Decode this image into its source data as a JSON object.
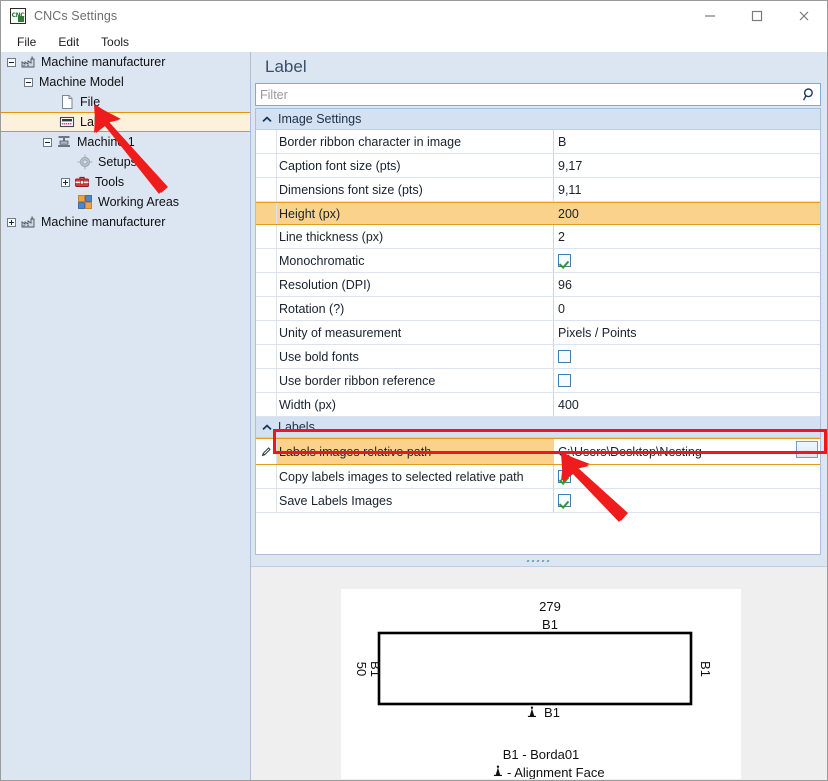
{
  "window": {
    "title": "CNCs Settings",
    "app_icon": "cnc-icon",
    "minimize_label": "Minimize",
    "maximize_label": "Maximize",
    "close_label": "Close"
  },
  "menubar": {
    "items": [
      {
        "label": "File",
        "name": "menu-file"
      },
      {
        "label": "Edit",
        "name": "menu-edit"
      },
      {
        "label": "Tools",
        "name": "menu-tools"
      }
    ]
  },
  "tree": {
    "nodes": [
      {
        "label": "Machine manufacturer",
        "icon": "factory-icon",
        "indent": 0,
        "expander": "minus",
        "selected": false
      },
      {
        "label": "Machine Model",
        "icon": "none",
        "indent": 1,
        "expander": "minus",
        "selected": false
      },
      {
        "label": "File",
        "icon": "document-icon",
        "indent": 2,
        "expander": "none",
        "selected": false
      },
      {
        "label": "Label",
        "icon": "label-icon",
        "indent": 2,
        "expander": "none",
        "selected": true
      },
      {
        "label": "Machine 1",
        "icon": "machine-icon",
        "indent": 2,
        "expander": "minus",
        "selected": false
      },
      {
        "label": "Setups",
        "icon": "gear-icon",
        "indent": 3,
        "expander": "none",
        "selected": false
      },
      {
        "label": "Tools",
        "icon": "toolbox-icon",
        "indent": 3,
        "expander": "plus",
        "selected": false
      },
      {
        "label": "Working Areas",
        "icon": "areas-icon",
        "indent": 3,
        "expander": "none",
        "selected": false
      },
      {
        "label": "Machine manufacturer",
        "icon": "factory-icon",
        "indent": 0,
        "expander": "plus",
        "selected": false
      }
    ]
  },
  "content": {
    "header": "Label",
    "filter": {
      "value": "",
      "placeholder": "Filter",
      "icon": "search-icon"
    },
    "categories": [
      {
        "name": "Image Settings",
        "chevron": "chevron-up-icon",
        "rows": [
          {
            "name": "Border ribbon character in image",
            "value": "B",
            "type": "text",
            "highlight": false,
            "gutter": "none"
          },
          {
            "name": "Caption font size (pts)",
            "value": "9,17",
            "type": "text",
            "highlight": false,
            "gutter": "none"
          },
          {
            "name": "Dimensions font size (pts)",
            "value": "9,11",
            "type": "text",
            "highlight": false,
            "gutter": "none"
          },
          {
            "name": "Height (px)",
            "value": "200",
            "type": "text",
            "highlight": true,
            "gutter": "none"
          },
          {
            "name": "Line thickness (px)",
            "value": "2",
            "type": "text",
            "highlight": false,
            "gutter": "none"
          },
          {
            "name": "Monochromatic",
            "value": "",
            "type": "checkbox",
            "checked": true,
            "highlight": false,
            "gutter": "none"
          },
          {
            "name": "Resolution (DPI)",
            "value": "96",
            "type": "text",
            "highlight": false,
            "gutter": "none"
          },
          {
            "name": "Rotation (?)",
            "value": "0",
            "type": "text",
            "highlight": false,
            "gutter": "none"
          },
          {
            "name": "Unity of measurement",
            "value": "Pixels / Points",
            "type": "text",
            "highlight": false,
            "gutter": "none"
          },
          {
            "name": "Use bold fonts",
            "value": "",
            "type": "checkbox",
            "checked": false,
            "highlight": false,
            "gutter": "none"
          },
          {
            "name": "Use border ribbon reference",
            "value": "",
            "type": "checkbox",
            "checked": false,
            "highlight": false,
            "gutter": "none"
          },
          {
            "name": "Width (px)",
            "value": "400",
            "type": "text",
            "highlight": false,
            "gutter": "none"
          }
        ]
      },
      {
        "name": "Labels",
        "chevron": "chevron-up-icon",
        "rows": [
          {
            "name": "Labels images relative path",
            "value": "C:\\Users\\Desktop\\Nesting",
            "type": "path",
            "button_label": "...",
            "highlight": true,
            "gutter": "pencil-icon"
          },
          {
            "name": "Copy labels images to selected relative path",
            "value": "",
            "type": "checkbox",
            "checked": true,
            "highlight": false,
            "gutter": "none"
          },
          {
            "name": "Save Labels Images",
            "value": "",
            "type": "checkbox",
            "checked": true,
            "highlight": false,
            "gutter": "none"
          }
        ]
      }
    ]
  },
  "preview": {
    "top_dimension": "279",
    "top_edge_label": "B1",
    "left_dimension": "50",
    "left_edge_label": "B1",
    "right_edge_label": "B1",
    "bottom_edge_label": "B1",
    "legend_line_1": "B1 - Borda01",
    "legend_line_2": "- Alignment Face",
    "alignment_glyph": "alignment-face-icon"
  },
  "annotations": {
    "arrow_tree_color": "#ee1c1c",
    "arrow_checkbox_color": "#ee1c1c",
    "highlight_box_color": "#f2151b",
    "row_highlight_color": "#fbd28c",
    "selection_border_color": "#e8920c"
  }
}
